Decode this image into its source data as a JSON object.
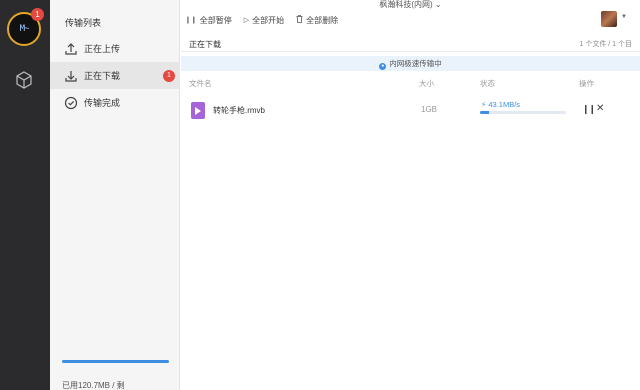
{
  "app": {
    "title": "枫瀚科技(内网) ⌄",
    "logo_text": "M~",
    "logo_badge": "1"
  },
  "sidebar": {
    "title": "传输列表",
    "items": [
      {
        "label": "正在上传",
        "icon": "upload-icon"
      },
      {
        "label": "正在下载",
        "icon": "download-icon",
        "badge": "1"
      },
      {
        "label": "传输完成",
        "icon": "check-circle-icon"
      }
    ],
    "usage_text": "已用120.7MB / 剩",
    "usage_fraction": 1.0
  },
  "toolbar": {
    "pause_all": "全部暂停",
    "start_all": "全部开始",
    "delete_all": "全部删除"
  },
  "section": {
    "title": "正在下载",
    "count": "1 个文件 / 1 个目"
  },
  "notice": {
    "text": "内网极速传输中"
  },
  "table": {
    "headers": {
      "name": "文件名",
      "size": "大小",
      "status": "状态",
      "actions": "操作"
    },
    "rows": [
      {
        "name": "转轮手枪.rmvb",
        "size": "1GB",
        "speed": "43.1MB/s",
        "progress_fraction": 0.1
      }
    ]
  },
  "colors": {
    "accent": "#3d8ee0",
    "badge": "#e5493f",
    "rail": "#2b2b2d",
    "file_icon": "#a564d8"
  }
}
